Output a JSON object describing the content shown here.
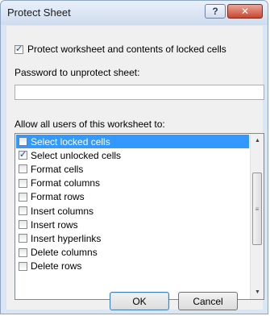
{
  "window": {
    "title": "Protect Sheet",
    "help_label": "?",
    "close_label": "✕"
  },
  "protect": {
    "label": "Protect worksheet and contents of locked cells",
    "checked": true
  },
  "password": {
    "label": "Password to unprotect sheet:",
    "value": "",
    "placeholder": ""
  },
  "allow": {
    "label": "Allow all users of this worksheet to:",
    "items": [
      {
        "label": "Select locked cells",
        "checked": false,
        "selected": true
      },
      {
        "label": "Select unlocked cells",
        "checked": true,
        "selected": false
      },
      {
        "label": "Format cells",
        "checked": false,
        "selected": false
      },
      {
        "label": "Format columns",
        "checked": false,
        "selected": false
      },
      {
        "label": "Format rows",
        "checked": false,
        "selected": false
      },
      {
        "label": "Insert columns",
        "checked": false,
        "selected": false
      },
      {
        "label": "Insert rows",
        "checked": false,
        "selected": false
      },
      {
        "label": "Insert hyperlinks",
        "checked": false,
        "selected": false
      },
      {
        "label": "Delete columns",
        "checked": false,
        "selected": false
      },
      {
        "label": "Delete rows",
        "checked": false,
        "selected": false
      }
    ]
  },
  "buttons": {
    "ok": "OK",
    "cancel": "Cancel"
  }
}
